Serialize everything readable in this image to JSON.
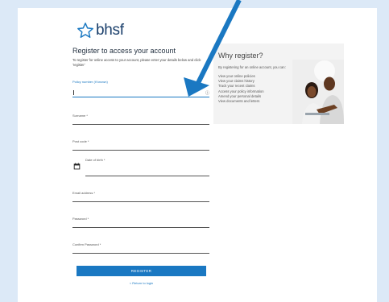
{
  "brand": {
    "name": "bhsf",
    "color": "#1a3f6b"
  },
  "accent_color": "#1a78c2",
  "form": {
    "title": "Register to access your account",
    "intro": "To register for online access to your account, please enter your details below and click 'register'",
    "fields": {
      "policy": {
        "label": "Policy number (if known)",
        "value": "",
        "info_icon": "info-icon"
      },
      "surname": {
        "label": "Surname *"
      },
      "postcode": {
        "label": "Post code *"
      },
      "dob": {
        "label": "Date of birth *",
        "icon": "calendar-icon"
      },
      "email": {
        "label": "Email address *"
      },
      "password": {
        "label": "Password *"
      },
      "confirm": {
        "label": "Confirm Password *"
      }
    },
    "register_label": "REGISTER",
    "return_label": "< Return to login"
  },
  "why": {
    "title": "Why register?",
    "subtitle": "By registering for an online account, you can:",
    "items": [
      "View your online policies",
      "View your claims history",
      "Track your recent claims",
      "Access your policy information",
      "Amend your personal details",
      "View documents and letters"
    ]
  }
}
